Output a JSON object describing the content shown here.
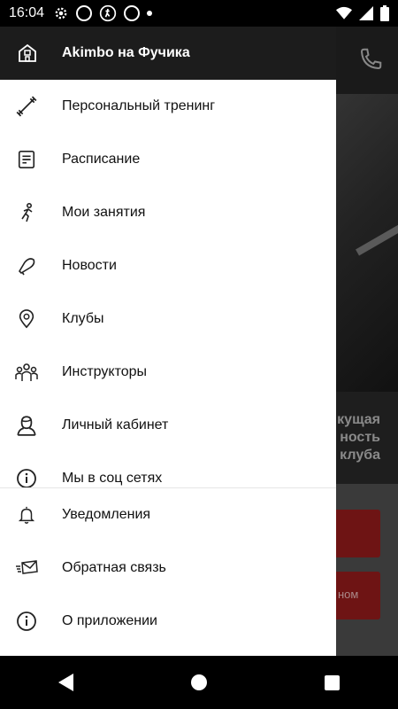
{
  "status_bar": {
    "time": "16:04",
    "icons": [
      "gear-icon",
      "notification-chip-icon",
      "running-man-icon",
      "notification-chip-icon",
      "dot-icon"
    ],
    "right_icons": [
      "wifi-icon",
      "signal-icon",
      "battery-icon"
    ]
  },
  "drawer": {
    "header": {
      "title": "Akimbo на Фучика",
      "icon": "building-icon"
    },
    "items": [
      {
        "label": "Персональный тренинг",
        "icon": "dumbbell-icon"
      },
      {
        "label": "Расписание",
        "icon": "document-icon"
      },
      {
        "label": "Мои занятия",
        "icon": "runner-icon"
      },
      {
        "label": "Новости",
        "icon": "megaphone-icon"
      },
      {
        "label": "Клубы",
        "icon": "location-pin-icon"
      },
      {
        "label": "Инструкторы",
        "icon": "group-icon"
      },
      {
        "label": "Личный кабинет",
        "icon": "person-icon"
      },
      {
        "label": "Мы в соц сетях",
        "icon": "info-icon"
      }
    ],
    "bottom_items": [
      {
        "label": "Уведомления",
        "icon": "bell-icon"
      },
      {
        "label": "Обратная связь",
        "icon": "envelope-icon"
      },
      {
        "label": "О приложении",
        "icon": "info-icon"
      }
    ]
  },
  "background": {
    "caption_lines": [
      "кущая",
      "ность",
      "клуба"
    ],
    "button2_text": "ном"
  },
  "colors": {
    "drawer_header": "#1c1c1c",
    "accent_red": "#6e1414"
  }
}
